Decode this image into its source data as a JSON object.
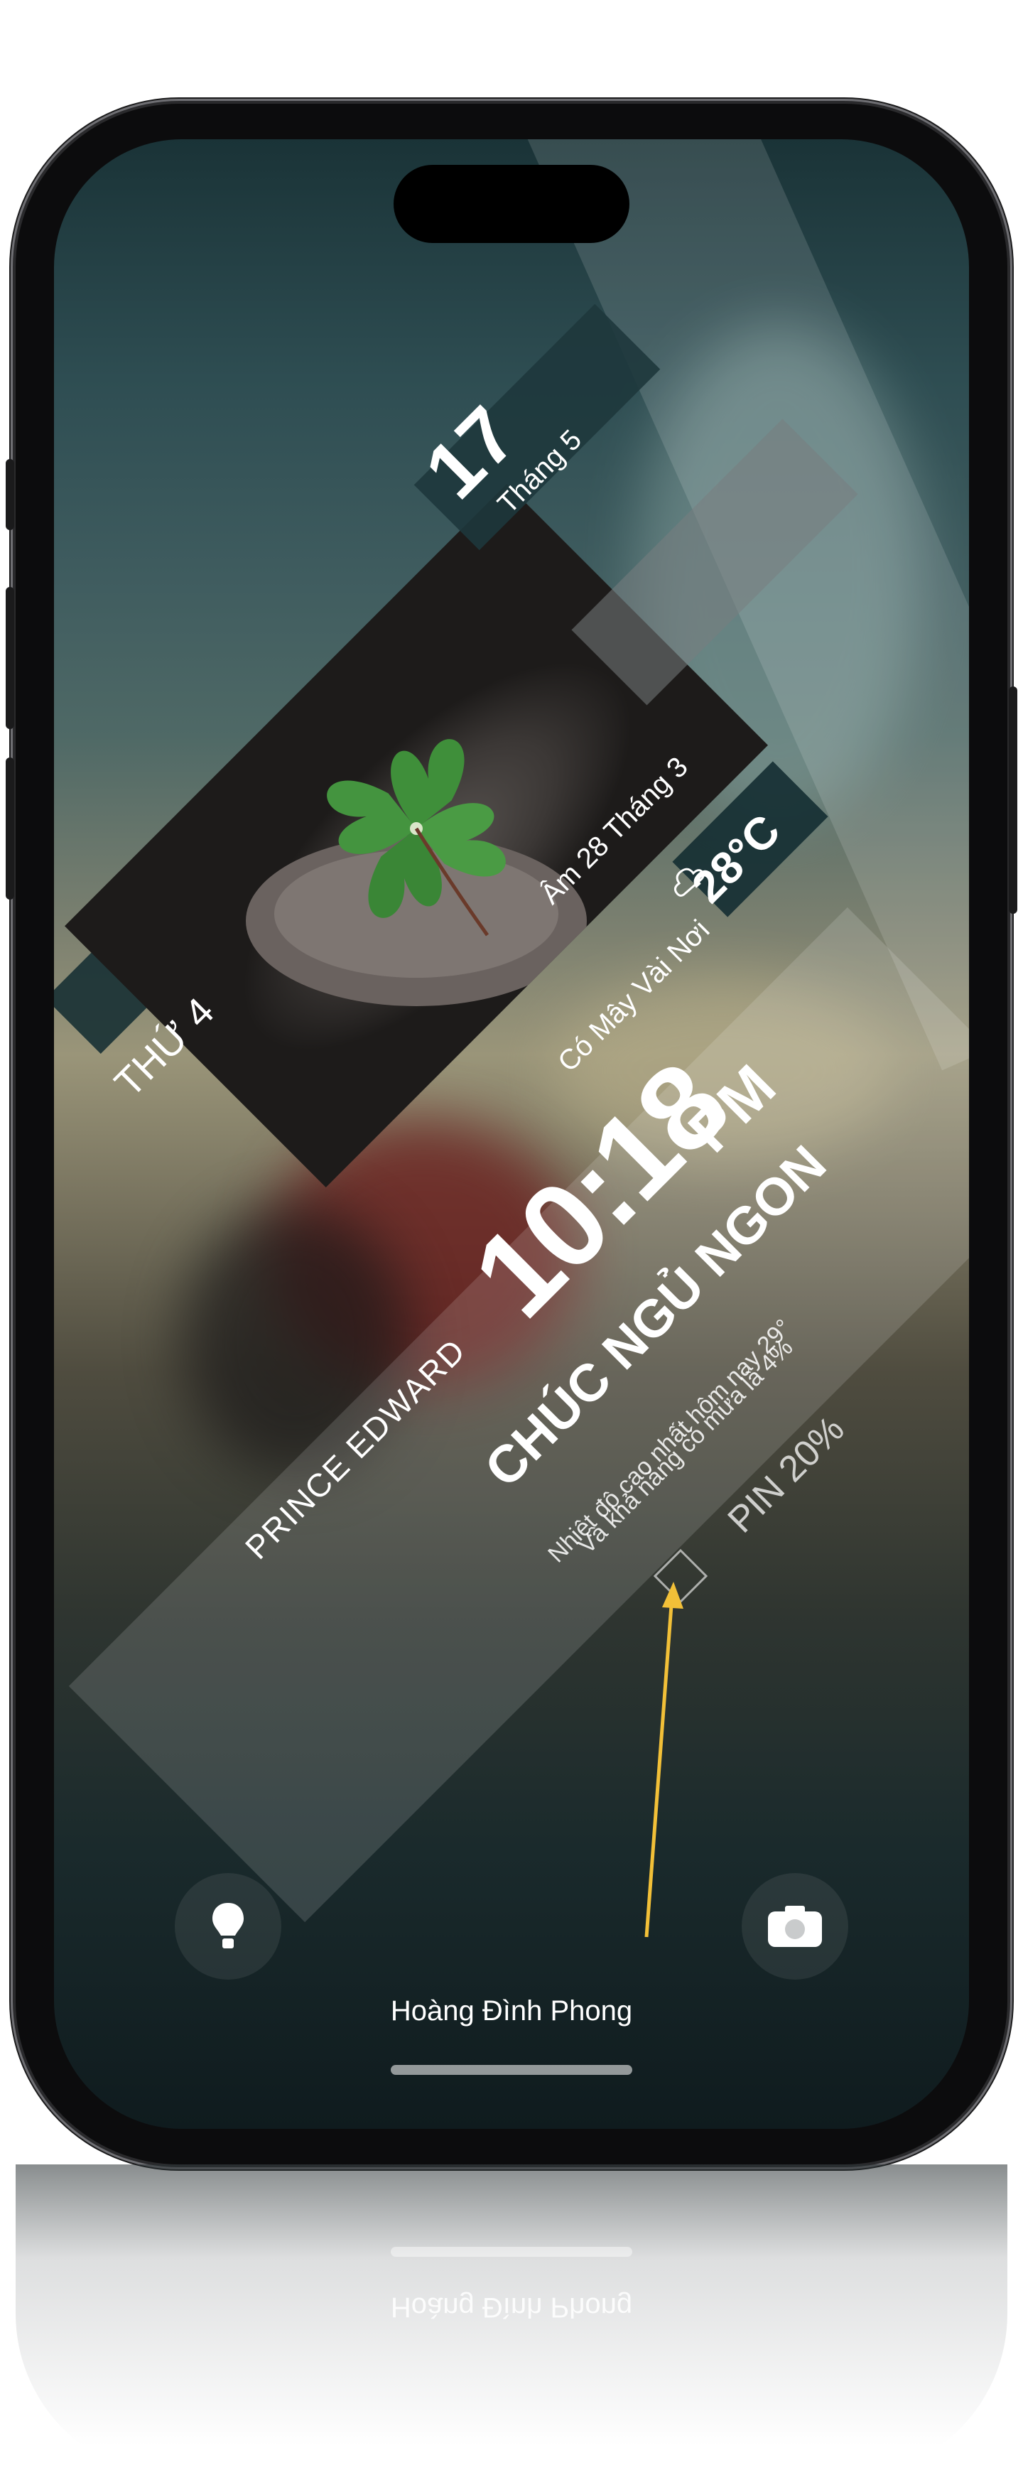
{
  "lockscreen": {
    "date_day": "17",
    "date_month": "Tháng 5",
    "weekday": "THỨ 4",
    "lunar_date": "Âm 28 Tháng 3",
    "temperature": "28°C",
    "weather_condition": "Có Mây Vài Nơi",
    "time": "10:18",
    "time_ampm": "PM",
    "greeting": "CHÚC NGỦ NGON",
    "location": "PRINCE EDWARD",
    "forecast_line1": "Nhiệt độ cao nhất hôm nay 29°",
    "forecast_line2": "Và khả năng có mưa là 4%",
    "battery": "PIN 20%"
  },
  "bottom": {
    "owner_name": "Hoàng Đình Phong",
    "left_icon": "flashlight-icon",
    "right_icon": "camera-icon"
  },
  "reflection": {
    "owner_name": "Hoàng Đình Phong"
  },
  "colors": {
    "accent_arrow": "#f2c038",
    "leaf_green": "#3f8f3a",
    "band_light": "rgba(255,255,255,0.18)"
  }
}
